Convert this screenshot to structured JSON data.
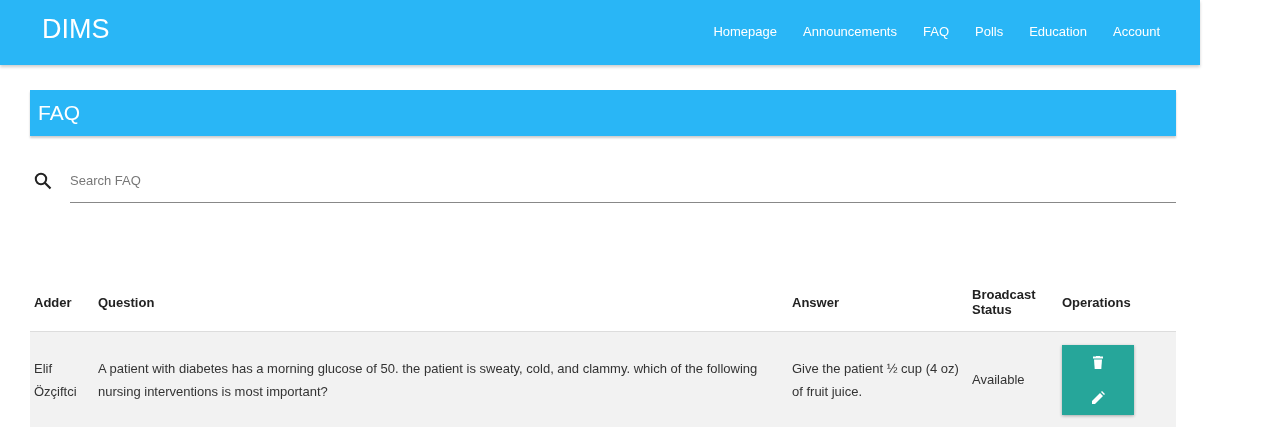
{
  "navbar": {
    "logo": "DIMS",
    "links": [
      "Homepage",
      "Announcements",
      "FAQ",
      "Polls",
      "Education",
      "Account"
    ]
  },
  "page_title": "FAQ",
  "search": {
    "placeholder": "Search FAQ"
  },
  "table": {
    "columns": [
      "Adder",
      "Question",
      "Answer",
      "Broadcast Status",
      "Operations"
    ],
    "rows": [
      {
        "adder": "Elif Özçiftci",
        "question": "A patient with diabetes has a morning glucose of 50. the patient is sweaty, cold, and clammy. which of the following nursing interventions is most important?",
        "answer": "Give the patient ½ cup (4 oz) of fruit juice.",
        "status": "Available"
      }
    ]
  }
}
